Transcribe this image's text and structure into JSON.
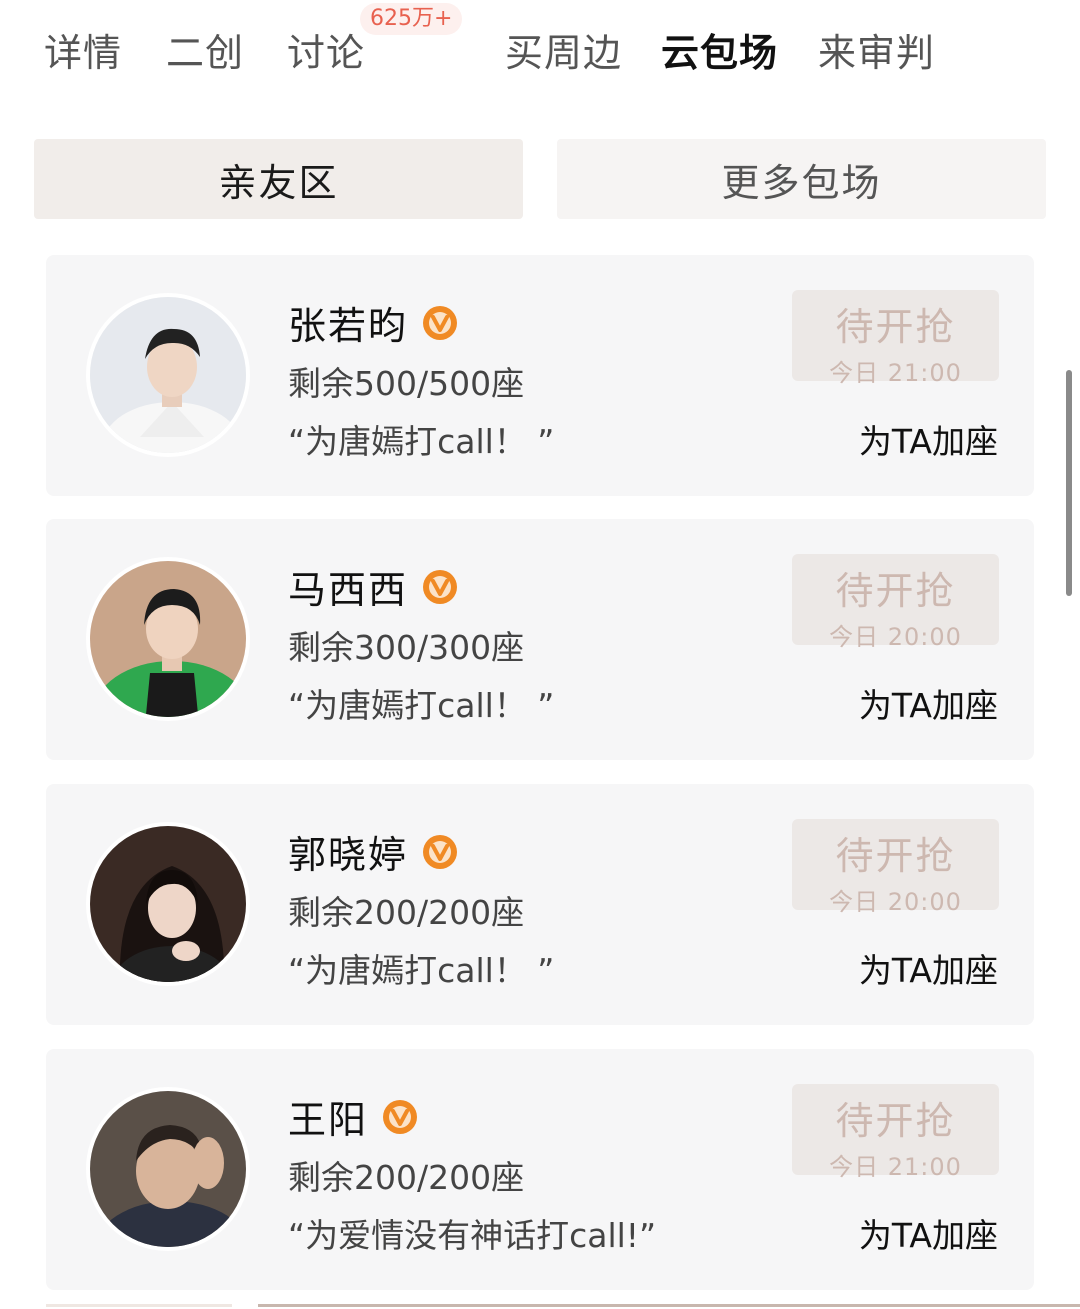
{
  "tabs": [
    {
      "label": "详情",
      "active": false
    },
    {
      "label": "二创",
      "active": false
    },
    {
      "label": "讨论",
      "active": false,
      "badge": "625万+"
    },
    {
      "label": "买周边",
      "active": false
    },
    {
      "label": "云包场",
      "active": true
    },
    {
      "label": "来审判",
      "active": false
    }
  ],
  "segments": {
    "friends": "亲友区",
    "more": "更多包场"
  },
  "cards": [
    {
      "name": "张若昀",
      "seats": "剩余500/500座",
      "slogan": "“为唐嫣打call！ ”",
      "status": "待开抢",
      "time": "今日 21:00",
      "action": "为TA加座"
    },
    {
      "name": "马西西",
      "seats": "剩余300/300座",
      "slogan": "“为唐嫣打call！ ”",
      "status": "待开抢",
      "time": "今日 20:00",
      "action": "为TA加座"
    },
    {
      "name": "郭晓婷",
      "seats": "剩余200/200座",
      "slogan": "“为唐嫣打call！ ”",
      "status": "待开抢",
      "time": "今日 20:00",
      "action": "为TA加座"
    },
    {
      "name": "王阳",
      "seats": "剩余200/200座",
      "slogan": "“为爱情没有神话打call!”",
      "status": "待开抢",
      "time": "今日 21:00",
      "action": "为TA加座"
    }
  ],
  "colors": {
    "badge_text": "#e8614f",
    "verified_badge": "#f08a24",
    "pending_text": "#cdb8b0"
  },
  "icons": {
    "verified": "verified-v-icon"
  }
}
